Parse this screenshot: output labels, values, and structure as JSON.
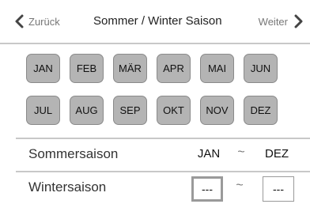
{
  "header": {
    "back_label": "Zurück",
    "title": "Sommer / Winter Saison",
    "next_label": "Weiter"
  },
  "icons": {
    "back": "chevron-left-icon",
    "next": "chevron-right-icon"
  },
  "months": {
    "row1": [
      "JAN",
      "FEB",
      "MÄR",
      "APR",
      "MAI",
      "JUN"
    ],
    "row2": [
      "JUL",
      "AUG",
      "SEP",
      "OKT",
      "NOV",
      "DEZ"
    ]
  },
  "summer": {
    "label": "Sommersaison",
    "from": "JAN",
    "separator": "~",
    "to": "DEZ"
  },
  "winter": {
    "label": "Wintersaison",
    "from": "---",
    "separator": "~",
    "to": "---"
  },
  "colors": {
    "month_button_bg": "#b4b4b4",
    "divider": "#c8c8c8",
    "selected_border": "#9a9a9a"
  }
}
